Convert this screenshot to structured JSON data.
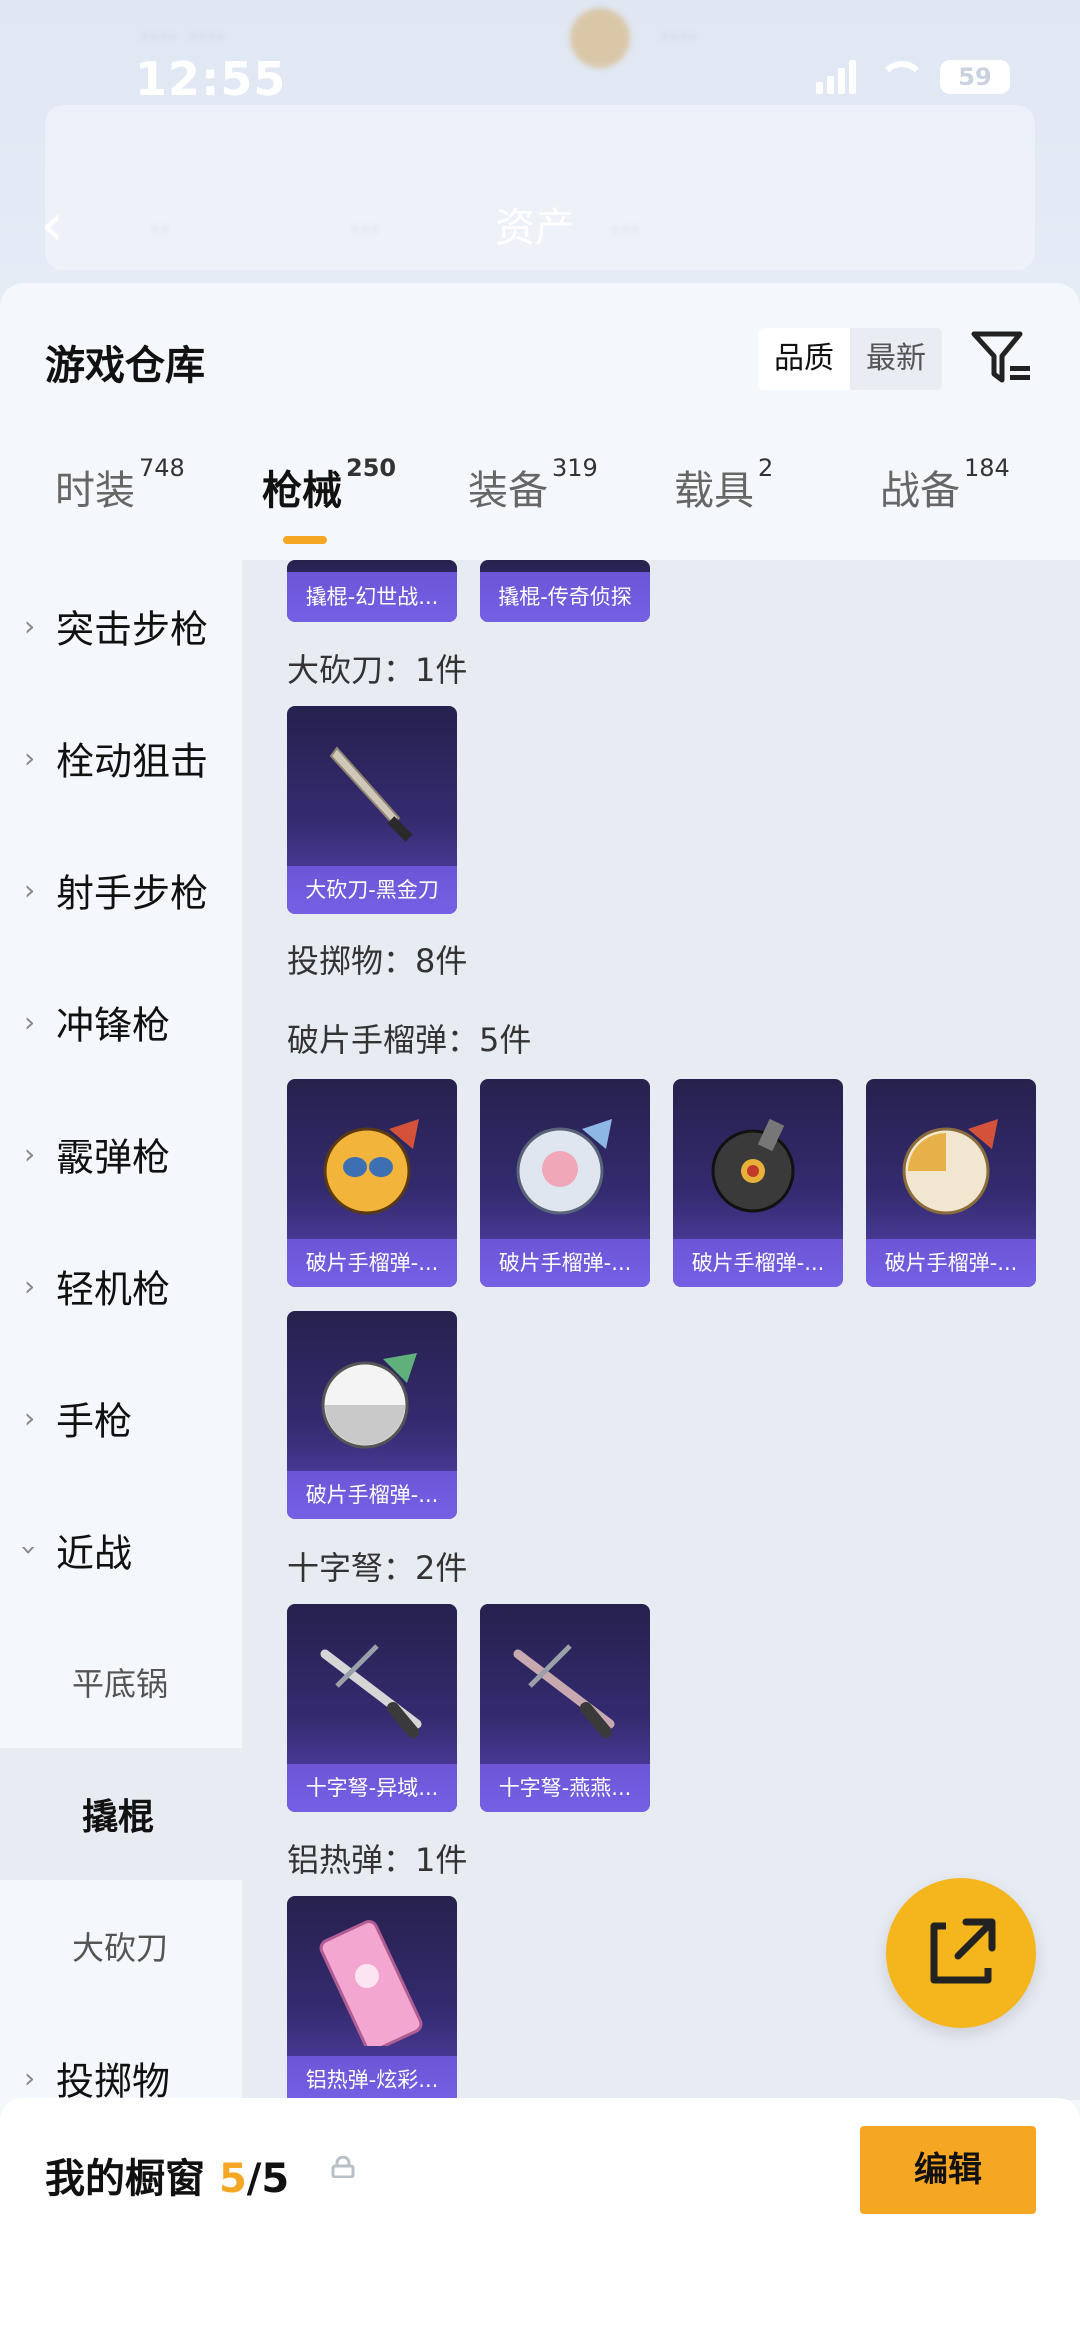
{
  "status_bar": {
    "time": "12:55",
    "battery": "59"
  },
  "bg_header": {
    "title": "资产"
  },
  "sheet": {
    "title": "游戏仓库",
    "sort_options": [
      "品质",
      "最新"
    ]
  },
  "tabs": [
    {
      "label": "时装",
      "count": "748"
    },
    {
      "label": "枪械",
      "count": "250"
    },
    {
      "label": "装备",
      "count": "319"
    },
    {
      "label": "载具",
      "count": "2"
    },
    {
      "label": "战备",
      "count": "184"
    }
  ],
  "sidenav": [
    {
      "label": "突击步枪"
    },
    {
      "label": "栓动狙击"
    },
    {
      "label": "射手步枪"
    },
    {
      "label": "冲锋枪"
    },
    {
      "label": "霰弹枪"
    },
    {
      "label": "轻机枪"
    },
    {
      "label": "手枪"
    },
    {
      "label": "近战"
    },
    {
      "label": "平底锅"
    },
    {
      "label": "撬棍"
    },
    {
      "label": "大砍刀"
    },
    {
      "label": "投掷物"
    }
  ],
  "content": {
    "crowbar_items": [
      "撬棍-幻世战...",
      "撬棍-传奇侦探"
    ],
    "machete_label": "大砍刀：1件",
    "machete_items": [
      "大砍刀-黑金刀"
    ],
    "throwables_label": "投掷物：8件",
    "frag_label": "破片手榴弹：5件",
    "frag_items": [
      "破片手榴弹-...",
      "破片手榴弹-...",
      "破片手榴弹-...",
      "破片手榴弹-...",
      "破片手榴弹-..."
    ],
    "crossbow_label": "十字弩：2件",
    "crossbow_items": [
      "十字弩-异域...",
      "十字弩-燕燕..."
    ],
    "thermite_label": "铝热弹：1件",
    "thermite_items": [
      "铝热弹-炫彩..."
    ]
  },
  "bottom": {
    "showcase_label": "我的橱窗",
    "showcase_count": "5",
    "showcase_total": "/5",
    "edit_label": "编辑"
  }
}
